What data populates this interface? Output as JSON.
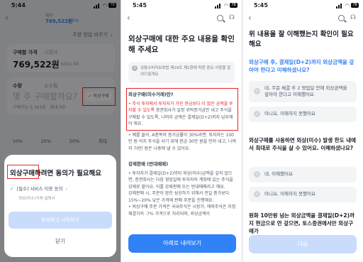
{
  "colors": {
    "accent": "#3182f6",
    "highlight_box": "#e5262a",
    "disabled_button": "#c9dcfb",
    "dim_overlay": "rgba(0,0,0,0.45)"
  },
  "panel1": {
    "status": {
      "time": "5:44",
      "battery": "78"
    },
    "header": {
      "symbol": "메타",
      "price": "769,522원",
      "change": "0.5%"
    },
    "order_method": "주문 방법 바꾸기 ⌄",
    "price_card": {
      "tab_active": "구매할 가격",
      "tab_other": "시장가",
      "price": "769,522원",
      "usd": "$552.58"
    },
    "qty_card": {
      "tab_active": "수량",
      "tab_other": "소수점",
      "placeholder": "몇 주 구매할까요?",
      "hint": "구매가능 5,361원 · 최대 0주",
      "fx_toggle": "외상구매"
    },
    "pct_buttons": [
      "10%",
      "25%",
      "50%",
      "최대"
    ],
    "sheet": {
      "title": "외상구매하려면 동의가 필요해요",
      "check_item": "[필수] 서비스 이용 동의",
      "sub_item": "외상(미수)거래 설명서",
      "agree_button": "동의하고 시작하기",
      "close_button": "닫기"
    }
  },
  "panel2": {
    "status": {
      "time": "5:45",
      "battery": "78"
    },
    "title": "외상구매에 대한 주요 내용을 확인해 주세요",
    "notice": "금융소비자보호법 제19조 제1항에 따른 중요 사항을 알려드릴게요.",
    "section1": {
      "heading": "외상구매(미수거래)란?",
      "bullet_red": "• 주식 투자에서 투자자가 가진 현금보다 더 많은 금액을 투자할 수 있도록",
      "bullet_rest": "증권회사가 일정 위탁증거금만 내고 주식을 구매할 수 있도록, 나머지 금액은 결제일(D+2)까지 납부해야 해요.",
      "bullet2": "• 예를 들어, A종목의 증거금률이 30%라면, 투자자는 100만 원 어치 주식을 사기 위해 현금 30만 원을 먼저 내고, 나머지 70만 원은 나중에 낼 수 있어요."
    },
    "section2": {
      "heading": "강제판매 (반대매매)",
      "bullet1": "• 투자자가 결제일(D+2)까지 외상(미수)금액을 갚지 않으면, 증권회사는 다음 영업일에 투자자의 계좌에 있는 주식을 강제로 팔아요. 이를 강제판매 또는 반대매매라고 해요.",
      "bullet2": "강제판매 시, 주문이 완전 성공하기 위해서 전일 종가보다 15%~20% 낮은 가격에 판매 주문을 진행해요.",
      "bullet3": "• 외상구매 주문 가격은 국내주식은 시장가, 해외주식은 지정 체결가의 -7% 가격으로 처리되며, 외상금액이"
    },
    "scroll_button": "아래로 내려보기"
  },
  "panel3": {
    "status": {
      "time": "5:45",
      "battery": "78"
    },
    "title": "위 내용을 잘 이해했는지 확인이 필요해요",
    "q1": "외상구매 후, 결제일(D+2)까지 외상금액을 갚아야 한다고 이해하셨나요?",
    "q1_options": [
      "네, 주문 체결 후 2 영업일 안에 외상금액을 갚아야 한다고 이해했어요",
      "아니요, 이해하지 못했어요"
    ],
    "q2": "외상구매를 사용하면 외상(미수) 발생 한도 내에서 최대로 주식을 살 수 있어요. 이해하셨나요?",
    "q2_options": [
      "네, 이해했어요",
      "아니요, 이해하지 못했어요"
    ],
    "q3": "원화 10만원 넘는 외상금액을 결제일(D+2)까지 현금으로 안 갚으면, 토스증권에서만 외상구매가",
    "next_button": "다음"
  }
}
